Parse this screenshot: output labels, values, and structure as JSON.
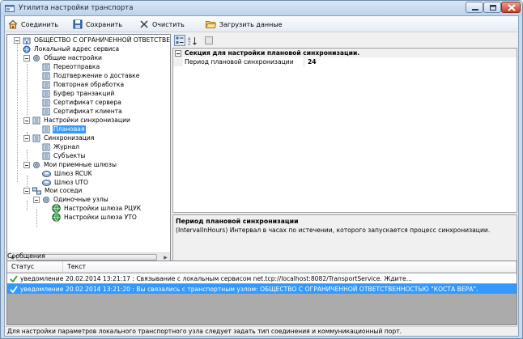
{
  "window": {
    "title": "Утилита настройки транспорта"
  },
  "toolbar": {
    "connect_label": "Соединить",
    "save_label": "Сохранить",
    "clear_label": "Очистить",
    "load_label": "Загрузить данные"
  },
  "tree": {
    "root": "ОБЩЕСТВО С ОГРАНИЧЕННОЙ ОТВЕТСТВЕННО",
    "local_address": "Локальный адрес сервиса",
    "general": "Общие настройки",
    "general_items": [
      "Переотправка",
      "Подтвержение о доставке",
      "Повторная обработка",
      "Буфер транзакций",
      "Сертификат сервера",
      "Сертификат клиента"
    ],
    "sync_settings": "Настройки синхронизации",
    "planned": "Плановая",
    "sync": "Синхронизация",
    "sync_items": [
      "Журнал",
      "Субъекты"
    ],
    "gateways": "Мои приемные шлюзы",
    "gateway_items": [
      "Шлюз RCUK",
      "Шлюз UTO"
    ],
    "neighbors": "Мои соседи",
    "single_nodes": "Одиночные узлы",
    "node_items": [
      "Настройки шлюза РЦУК",
      "Настройки шлюза УТО"
    ]
  },
  "property_grid": {
    "section": "Секция для настройки плановой синхронизации.",
    "row_name": "Период плановой синхронизации",
    "row_value": "24",
    "help_title": "Период плановой синхронизации",
    "help_text": "(IntervalInHours) Интервал в часах по истечении, которого запускается процесс синхронизации."
  },
  "messages": {
    "caption": "Сообщения",
    "col_status": "Статус",
    "col_text": "Текст",
    "rows": [
      {
        "type": "уведомление",
        "text": "20.02.2014 13:21:17 : Связывание с локальным сервисом net.tcp://localhost:8082/TransportService. Ждите..."
      },
      {
        "type": "уведомление",
        "text": "20.02.2014 13:21:20 : Вы связались с транспортным узлом: ОБЩЕСТВО С ОГРАНИЧЕННОЙ ОТВЕТСТВЕННОСТЬЮ \"КОСТА ВЕРА\"."
      }
    ]
  },
  "statusbar": {
    "text": "Для настройки параметров локального транспортного узла следует задать тип соединения и коммуникационный порт."
  },
  "colors": {
    "selection": "#3399ff",
    "titlebar": "#c7daee",
    "close": "#c7402a"
  }
}
